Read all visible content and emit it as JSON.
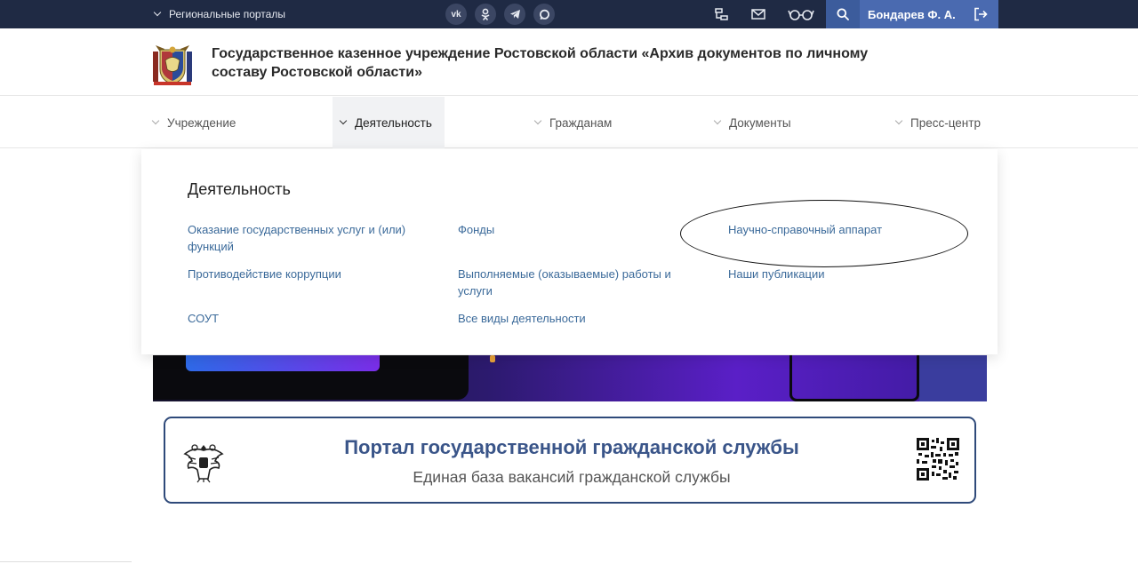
{
  "topbar": {
    "regional_label": "Региональные порталы",
    "social_icons": [
      "vk-icon",
      "odnoklassniki-icon",
      "telegram-icon",
      "max-messenger-icon"
    ],
    "user_name": "Бондарев Ф. А.",
    "colors": {
      "bg": "#1f2a44",
      "search_bg": "#3c5c9c",
      "user_bg": "#4a6ab0"
    }
  },
  "header": {
    "org_title": "Государственное казенное учреждение Ростовской области «Архив документов по личному составу Ростовской области»"
  },
  "nav": {
    "items": [
      {
        "label": "Учреждение"
      },
      {
        "label": "Деятельность",
        "active": true
      },
      {
        "label": "Гражданам"
      },
      {
        "label": "Документы"
      },
      {
        "label": "Пресс-центр"
      }
    ]
  },
  "dropdown": {
    "title": "Деятельность",
    "links": [
      "Оказание государственных услуг и (или) функций",
      "Фонды",
      "Научно-справочный аппарат",
      "Противодействие коррупции",
      "Выполняемые (оказываемые) работы и услуги",
      "Наши публикации",
      "СОУТ",
      "Все виды деятельности"
    ]
  },
  "portal": {
    "title": "Портал государственной гражданской службы",
    "subtitle": "Единая база вакансий гражданской службы"
  }
}
